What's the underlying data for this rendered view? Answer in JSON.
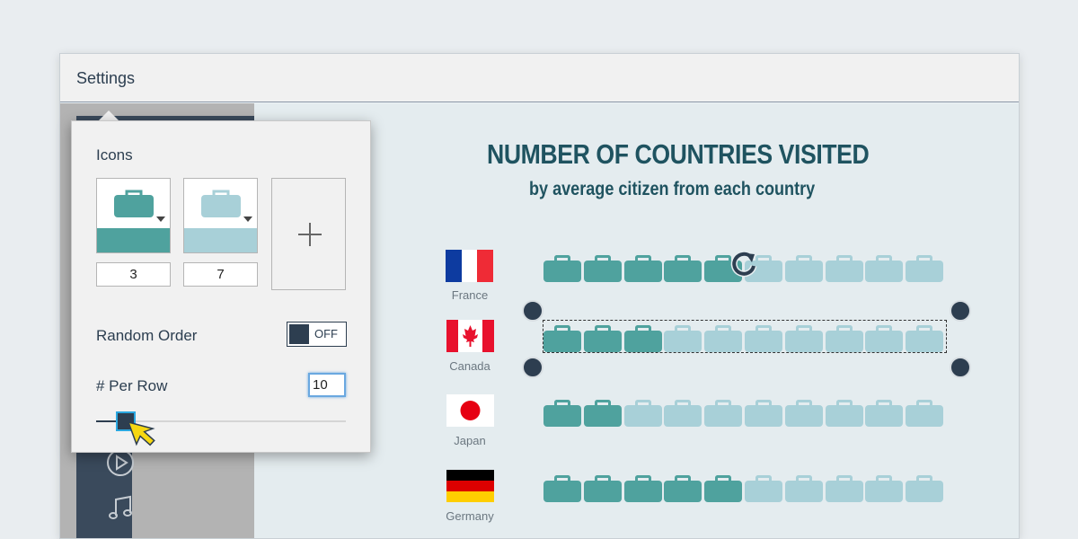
{
  "window": {
    "title": "Settings"
  },
  "chart": {
    "title": "NUMBER OF COUNTRIES VISITED",
    "subtitle": "by average citizen from each country",
    "per_row": 10,
    "rows": [
      {
        "country": "France",
        "dark": 5,
        "light": 5
      },
      {
        "country": "Canada",
        "dark": 3,
        "light": 7
      },
      {
        "country": "Japan",
        "dark": 2,
        "light": 8
      },
      {
        "country": "Germany",
        "dark": 5,
        "light": 5
      }
    ]
  },
  "chart_data": {
    "type": "table",
    "title": "NUMBER OF COUNTRIES VISITED",
    "subtitle": "by average citizen from each country",
    "categories": [
      "France",
      "Canada",
      "Japan",
      "Germany"
    ],
    "values": [
      5,
      3,
      2,
      5
    ]
  },
  "settings": {
    "icons_label": "Icons",
    "icon1_count": "3",
    "icon2_count": "7",
    "random_order_label": "Random Order",
    "toggle_text": "OFF",
    "per_row_label": "# Per Row",
    "per_row_value": "10",
    "slider_fraction": 0.08
  },
  "colors": {
    "dark_icon": "#4fa29e",
    "light_icon": "#a8d0d8",
    "title": "#1f5360",
    "navy": "#2d3e50"
  }
}
